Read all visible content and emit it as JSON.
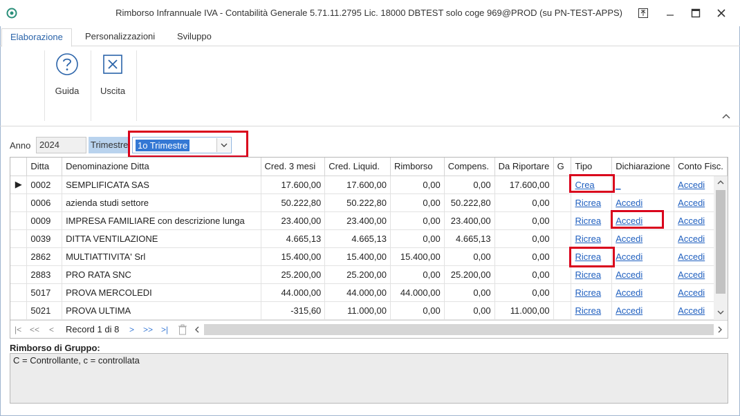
{
  "window": {
    "title": "Rimborso Infrannuale IVA - Contabilità Generale 5.71.11.2795 Lic. 18000 DBTEST solo coge 969@PROD (su PN-TEST-APPS)"
  },
  "ribbon": {
    "tabs": [
      {
        "label": "Elaborazione",
        "active": true
      },
      {
        "label": "Personalizzazioni",
        "active": false
      },
      {
        "label": "Sviluppo",
        "active": false
      }
    ],
    "buttons": [
      {
        "label": "Guida",
        "icon": "help-icon"
      },
      {
        "label": "Uscita",
        "icon": "close-box-icon"
      }
    ]
  },
  "filters": {
    "anno_label": "Anno",
    "anno_value": "2024",
    "trimestre_label": "Trimestre",
    "trimestre_value": "1o Trimestre"
  },
  "grid": {
    "columns": [
      "Ditta",
      "Denominazione Ditta",
      "Cred. 3 mesi",
      "Cred. Liquid.",
      "Rimborso",
      "Compens.",
      "Da Riportare",
      "G",
      "Tipo",
      "Dichiarazione",
      "Conto Fisc."
    ],
    "rows": [
      {
        "ditta": "0002",
        "denominazione": "SEMPLIFICATA SAS",
        "cred3": "17.600,00",
        "credliq": "17.600,00",
        "rimborso": "0,00",
        "compens": "0,00",
        "riportare": "17.600,00",
        "g": "",
        "tipo": "Crea",
        "dichiarazione": "_",
        "conto": "Accedi"
      },
      {
        "ditta": "0006",
        "denominazione": "azienda studi settore",
        "cred3": "50.222,80",
        "credliq": "50.222,80",
        "rimborso": "0,00",
        "compens": "50.222,80",
        "riportare": "0,00",
        "g": "",
        "tipo": "Ricrea",
        "dichiarazione": "Accedi",
        "conto": "Accedi"
      },
      {
        "ditta": "0009",
        "denominazione": "IMPRESA FAMILIARE con descrizione lunga",
        "cred3": "23.400,00",
        "credliq": "23.400,00",
        "rimborso": "0,00",
        "compens": "23.400,00",
        "riportare": "0,00",
        "g": "",
        "tipo": "Ricrea",
        "dichiarazione": "Accedi",
        "conto": "Accedi"
      },
      {
        "ditta": "0039",
        "denominazione": "DITTA VENTILAZIONE",
        "cred3": "4.665,13",
        "credliq": "4.665,13",
        "rimborso": "0,00",
        "compens": "4.665,13",
        "riportare": "0,00",
        "g": "",
        "tipo": "Ricrea",
        "dichiarazione": "Accedi",
        "conto": "Accedi"
      },
      {
        "ditta": "2862",
        "denominazione": "MULTIATTIVITA' Srl",
        "cred3": "15.400,00",
        "credliq": "15.400,00",
        "rimborso": "15.400,00",
        "compens": "0,00",
        "riportare": "0,00",
        "g": "",
        "tipo": "Ricrea",
        "dichiarazione": "Accedi",
        "conto": "Accedi"
      },
      {
        "ditta": "2883",
        "denominazione": "PRO RATA SNC",
        "cred3": "25.200,00",
        "credliq": "25.200,00",
        "rimborso": "0,00",
        "compens": "25.200,00",
        "riportare": "0,00",
        "g": "",
        "tipo": "Ricrea",
        "dichiarazione": "Accedi",
        "conto": "Accedi"
      },
      {
        "ditta": "5017",
        "denominazione": "PROVA MERCOLEDI",
        "cred3": "44.000,00",
        "credliq": "44.000,00",
        "rimborso": "44.000,00",
        "compens": "0,00",
        "riportare": "0,00",
        "g": "",
        "tipo": "Ricrea",
        "dichiarazione": "Accedi",
        "conto": "Accedi"
      },
      {
        "ditta": "5021",
        "denominazione": "PROVA ULTIMA",
        "cred3": "-315,60",
        "credliq": "11.000,00",
        "rimborso": "0,00",
        "compens": "0,00",
        "riportare": "11.000,00",
        "g": "",
        "tipo": "Ricrea",
        "dichiarazione": "Accedi",
        "conto": "Accedi"
      }
    ],
    "navigator": {
      "record_text": "Record 1 di 8"
    }
  },
  "group_panel": {
    "label": "Rimborso di Gruppo:",
    "text": "C = Controllante, c = controllata"
  },
  "colors": {
    "accent": "#2a63a9",
    "highlight_box": "#d9001b",
    "link": "#1f5fbf",
    "selection": "#3478d4"
  }
}
